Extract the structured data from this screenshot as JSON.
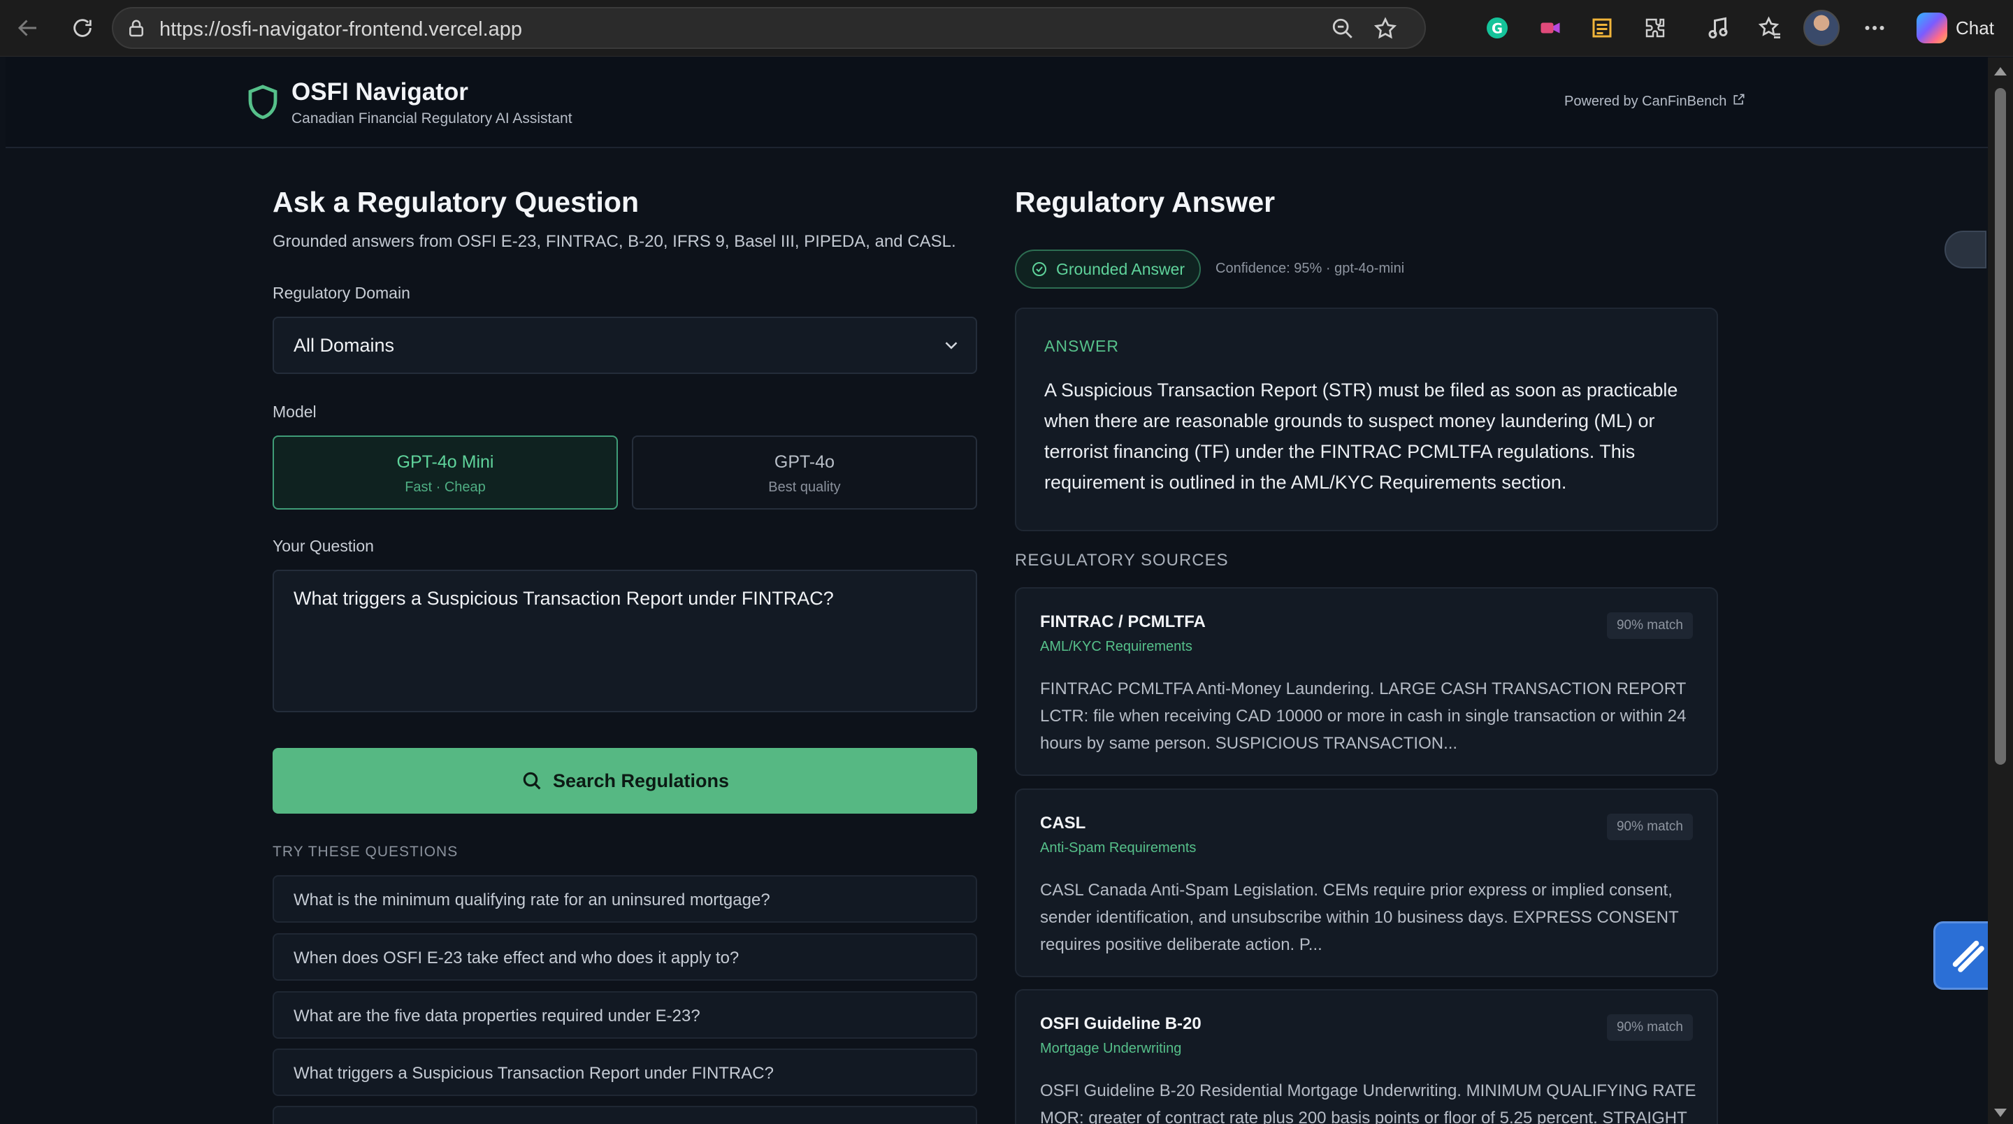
{
  "browser": {
    "url": "https://osfi-navigator-frontend.vercel.app",
    "chat_label": "Chat"
  },
  "header": {
    "title": "OSFI Navigator",
    "subtitle": "Canadian Financial Regulatory AI Assistant",
    "powered_by": "Powered by CanFinBench"
  },
  "ask": {
    "heading": "Ask a Regulatory Question",
    "description": "Grounded answers from OSFI E-23, FINTRAC, B-20, IFRS 9, Basel III, PIPEDA, and CASL.",
    "domain_label": "Regulatory Domain",
    "domain_value": "All Domains",
    "model_label": "Model",
    "models": [
      {
        "name": "GPT-4o Mini",
        "sub": "Fast · Cheap",
        "selected": true
      },
      {
        "name": "GPT-4o",
        "sub": "Best quality",
        "selected": false
      }
    ],
    "question_label": "Your Question",
    "question_value": "What triggers a Suspicious Transaction Report under FINTRAC?",
    "search_label": "Search Regulations",
    "try_heading": "TRY THESE QUESTIONS",
    "try_questions": [
      "What is the minimum qualifying rate for an uninsured mortgage?",
      "When does OSFI E-23 take effect and who does it apply to?",
      "What are the five data properties required under E-23?",
      "What triggers a Suspicious Transaction Report under FINTRAC?"
    ]
  },
  "answer": {
    "heading": "Regulatory Answer",
    "grounded_label": "Grounded Answer",
    "confidence": "Confidence: 95% · gpt-4o-mini",
    "answer_heading": "ANSWER",
    "answer_text": "A Suspicious Transaction Report (STR) must be filed as soon as practicable when there are reasonable grounds to suspect money laundering (ML) or terrorist financing (TF) under the FINTRAC PCMLTFA regulations. This requirement is outlined in the AML/KYC Requirements section.",
    "sources_heading": "REGULATORY SOURCES",
    "sources": [
      {
        "title": "FINTRAC / PCMLTFA",
        "section": "AML/KYC Requirements",
        "match": "90% match",
        "excerpt": "FINTRAC PCMLTFA Anti-Money Laundering. LARGE CASH TRANSACTION REPORT LCTR: file when receiving CAD 10000 or more in cash in single transaction or within 24 hours by same person. SUSPICIOUS TRANSACTION..."
      },
      {
        "title": "CASL",
        "section": "Anti-Spam Requirements",
        "match": "90% match",
        "excerpt": "CASL Canada Anti-Spam Legislation. CEMs require prior express or implied consent, sender identification, and unsubscribe within 10 business days. EXPRESS CONSENT requires positive deliberate action. P..."
      },
      {
        "title": "OSFI Guideline B-20",
        "section": "Mortgage Underwriting",
        "match": "90% match",
        "excerpt": "OSFI Guideline B-20 Residential Mortgage Underwriting. MINIMUM QUALIFYING RATE MQR: greater of contract rate plus 200 basis points or floor of 5.25 percent. STRAIGHT"
      }
    ]
  },
  "colors": {
    "accent": "#56b883",
    "background": "#0d121a",
    "card": "#131a24"
  }
}
